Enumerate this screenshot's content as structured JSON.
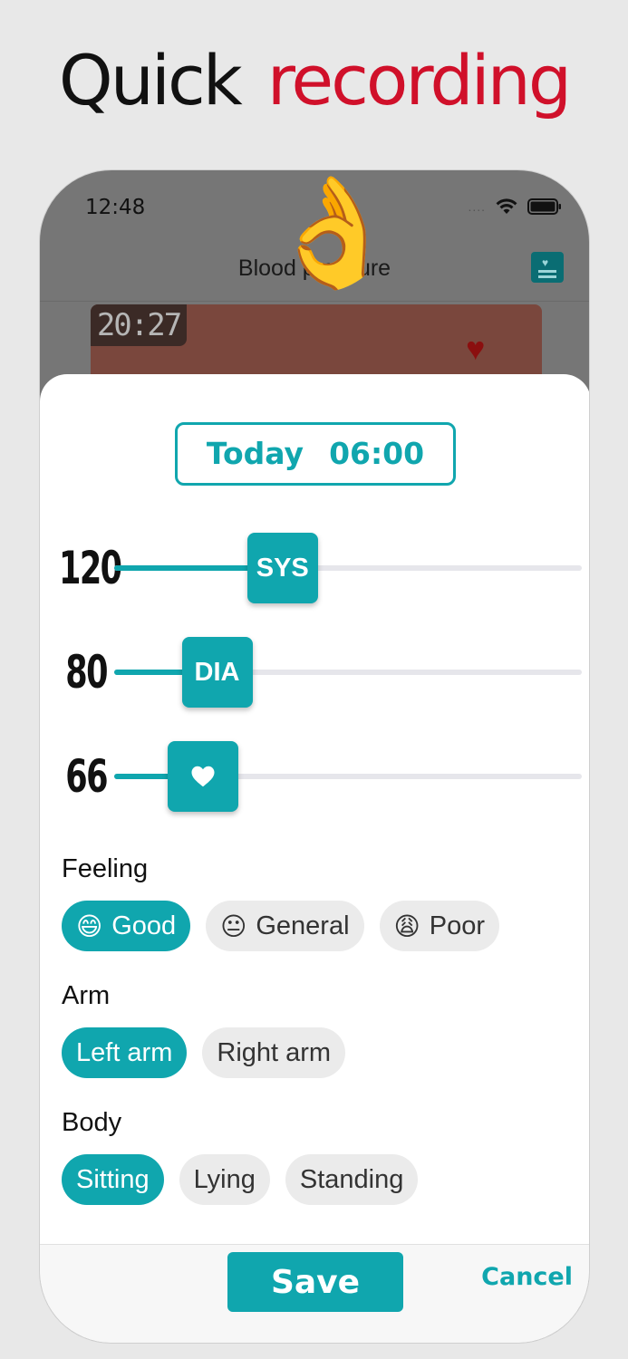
{
  "headline": {
    "word1": "Quick",
    "word2": "recording"
  },
  "status_bar": {
    "time": "12:48",
    "signal_dots": "...."
  },
  "background_screen": {
    "nav_title": "Blood pressure",
    "record_time": "20:27"
  },
  "decoration": {
    "hand_emoji": "👌"
  },
  "sheet": {
    "date_label": "Today",
    "date_time": "06:00",
    "sliders": [
      {
        "name": "sys",
        "value": "120",
        "thumb_label": "SYS",
        "fill_fraction": 0.36
      },
      {
        "name": "dia",
        "value": "80",
        "thumb_label": "DIA",
        "fill_fraction": 0.22
      },
      {
        "name": "pulse",
        "value": "66",
        "thumb_label": "",
        "thumb_icon": "heart-icon",
        "fill_fraction": 0.19
      }
    ],
    "feeling": {
      "label": "Feeling",
      "options": [
        {
          "emoji": "😄",
          "label": "Good",
          "selected": true
        },
        {
          "emoji": "😐",
          "label": "General",
          "selected": false
        },
        {
          "emoji": "😩",
          "label": "Poor",
          "selected": false
        }
      ]
    },
    "arm": {
      "label": "Arm",
      "options": [
        {
          "label": "Left arm",
          "selected": true
        },
        {
          "label": "Right arm",
          "selected": false
        }
      ]
    },
    "body": {
      "label": "Body",
      "options": [
        {
          "label": "Sitting",
          "selected": true
        },
        {
          "label": "Lying",
          "selected": false
        },
        {
          "label": "Standing",
          "selected": false
        }
      ]
    },
    "save_label": "Save",
    "cancel_label": "Cancel"
  },
  "colors": {
    "accent": "#10a6ae",
    "headline_red": "#d0102a",
    "background": "#e8e8e8"
  }
}
